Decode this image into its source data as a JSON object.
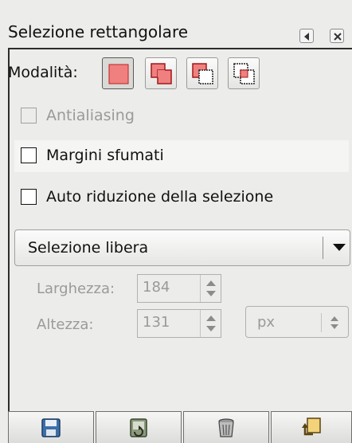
{
  "window": {
    "title": "Selezione rettangolare"
  },
  "mode": {
    "label": "Modalità:",
    "buttons": [
      {
        "icon": "replace-selection-icon",
        "active": true
      },
      {
        "icon": "add-selection-icon",
        "active": false
      },
      {
        "icon": "subtract-selection-icon",
        "active": false
      },
      {
        "icon": "intersect-selection-icon",
        "active": false
      }
    ]
  },
  "options": {
    "antialiasing": {
      "label": "Antialiasing",
      "checked": false,
      "enabled": false
    },
    "feather": {
      "label": "Margini sfumati",
      "checked": false,
      "enabled": true
    },
    "auto_shrink": {
      "label": "Auto riduzione della selezione",
      "checked": false,
      "enabled": true
    }
  },
  "selection_type": {
    "selected": "Selezione libera"
  },
  "size": {
    "width_label": "Larghezza:",
    "width_value": "184",
    "height_label": "Altezza:",
    "height_value": "131",
    "unit": "px"
  },
  "bottom_buttons": [
    {
      "icon": "save-options-icon"
    },
    {
      "icon": "restore-options-icon"
    },
    {
      "icon": "delete-options-icon"
    },
    {
      "icon": "reset-options-icon"
    }
  ],
  "colors": {
    "selection_fill": "#f08080",
    "selection_stroke": "#c02020",
    "panel_background": "#ececea"
  }
}
